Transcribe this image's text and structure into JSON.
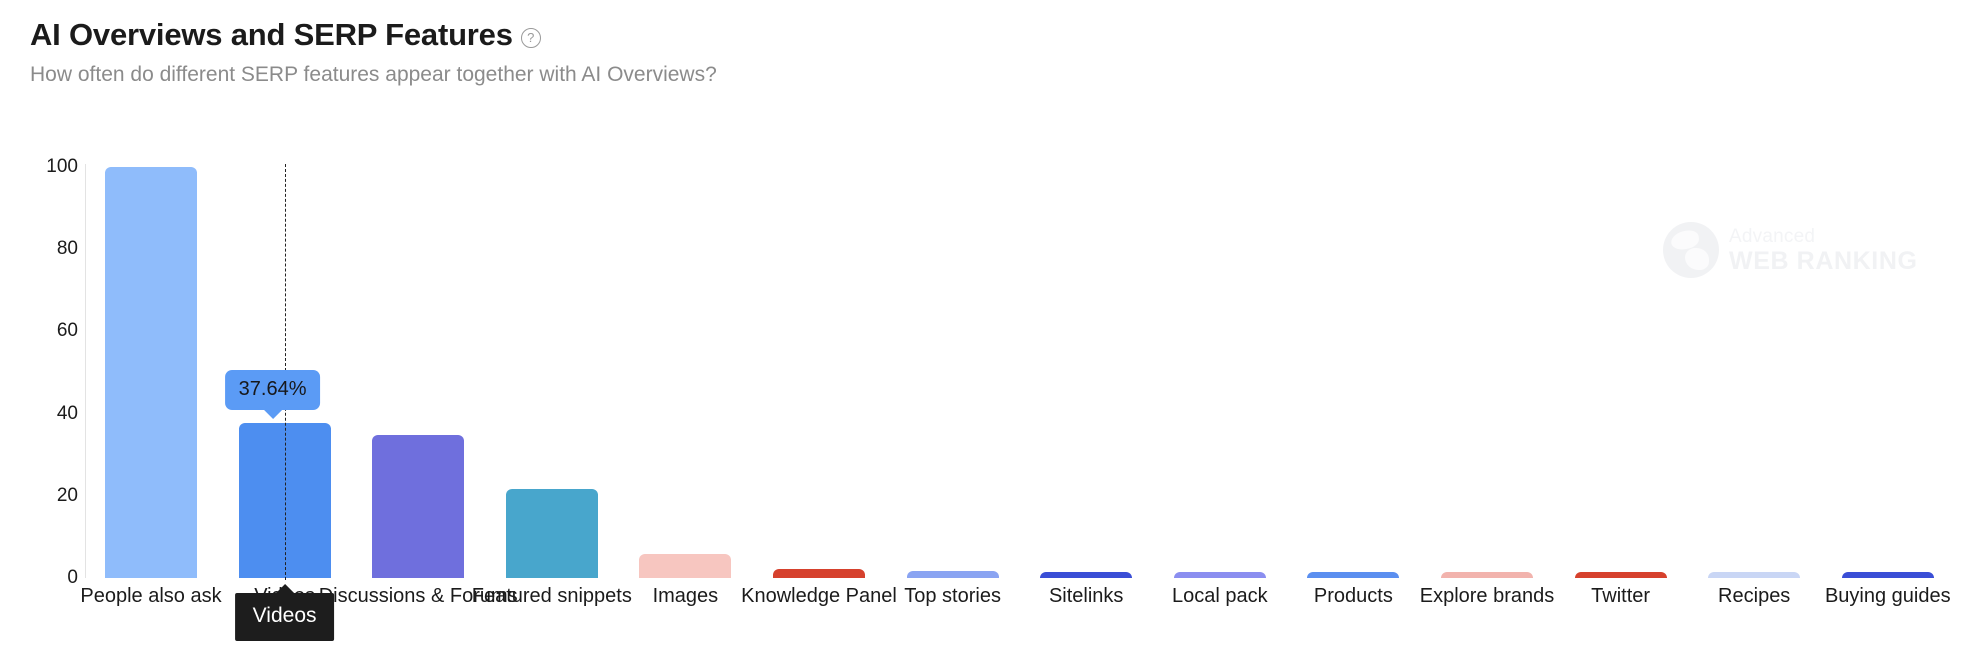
{
  "header": {
    "title": "AI Overviews and SERP Features",
    "help_icon": "question-circle-icon",
    "subtitle": "How often do different SERP features appear together with AI Overviews?"
  },
  "watermark": {
    "line1": "Advanced",
    "line2": "WEB RANKING",
    "icon": "globe-icon"
  },
  "tooltip": {
    "category": "Videos",
    "value_label": "37.64%"
  },
  "chart_data": {
    "type": "bar",
    "title": "AI Overviews and SERP Features",
    "subtitle": "How often do different SERP features appear together with AI Overviews?",
    "xlabel": "",
    "ylabel": "",
    "ylim": [
      0,
      100
    ],
    "yticks": [
      0,
      20,
      40,
      60,
      80,
      100
    ],
    "grid": false,
    "legend": "none",
    "categories": [
      "People also ask",
      "Videos",
      "Discussions & Forums",
      "Featured snippets",
      "Images",
      "Knowledge Panel",
      "Top stories",
      "Sitelinks",
      "Local pack",
      "Products",
      "Explore brands",
      "Twitter",
      "Recipes",
      "Buying guides"
    ],
    "values": [
      100,
      37.64,
      34.8,
      21.6,
      5.8,
      2.2,
      1.7,
      1.2,
      0.9,
      0.8,
      0.5,
      0.45,
      0.4,
      0.4
    ],
    "colors": [
      "#8fbcfb",
      "#4d8ef0",
      "#6f6fdd",
      "#48a6cc",
      "#f7c6c0",
      "#d6412d",
      "#8aa4f2",
      "#3a4ed6",
      "#8b8ef0",
      "#5b8ff0",
      "#f2b3ad",
      "#d6412d",
      "#c9d6f5",
      "#3a4ed6"
    ],
    "highlight_index": 1,
    "highlight_value_label": "37.64%"
  }
}
